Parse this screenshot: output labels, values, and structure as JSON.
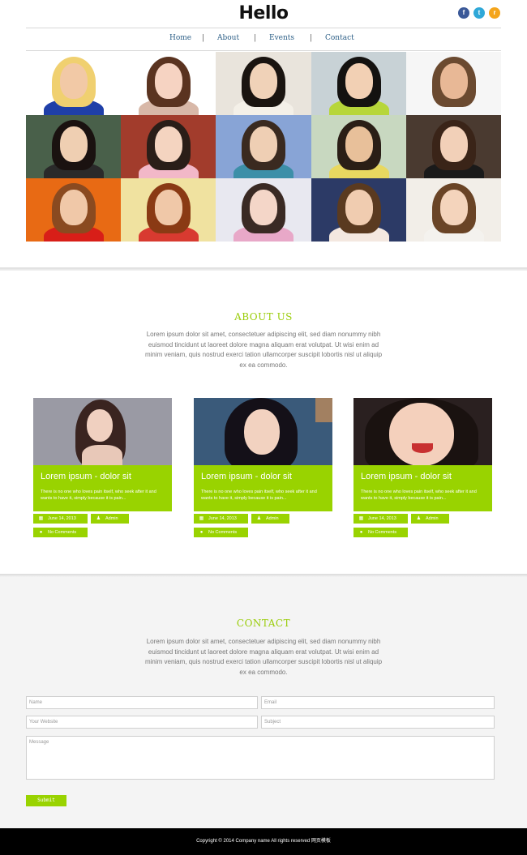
{
  "header": {
    "logo": "Hello",
    "social": [
      {
        "icon": "facebook-icon",
        "glyph": "f",
        "color": "#3b5998"
      },
      {
        "icon": "twitter-icon",
        "glyph": "t",
        "color": "#2fa8d8"
      },
      {
        "icon": "rss-icon",
        "glyph": "r",
        "color": "#f4a51c"
      }
    ]
  },
  "nav": {
    "items": [
      "Home",
      "About",
      "Events",
      "Contact"
    ],
    "separator": "|"
  },
  "gallery": {
    "tiles": [
      {
        "bg": "#ffffff",
        "skin": "#f2c9a6",
        "hair": "#f0d070",
        "shirt": "#1f3fa8"
      },
      {
        "bg": "#ffffff",
        "skin": "#f6d3c2",
        "hair": "#5a3320",
        "shirt": "#d8b8a8"
      },
      {
        "bg": "#e9e4dc",
        "skin": "#f0d2b8",
        "hair": "#1a1410",
        "shirt": "#f4f0e8"
      },
      {
        "bg": "#c8d2d6",
        "skin": "#f2d0b4",
        "hair": "#141210",
        "shirt": "#b7d63a"
      },
      {
        "bg": "#f6f6f6",
        "skin": "#e8b896",
        "hair": "#6b4a30",
        "shirt": "#f6f6f6"
      },
      {
        "bg": "#49604a",
        "skin": "#efcfb2",
        "hair": "#1a1210",
        "shirt": "#2a2a2a"
      },
      {
        "bg": "#a23c2c",
        "skin": "#f4d4c0",
        "hair": "#2a1e18",
        "shirt": "#f2b8c8"
      },
      {
        "bg": "#88a4d6",
        "skin": "#efcfb4",
        "hair": "#3a2a20",
        "shirt": "#3c8fa8"
      },
      {
        "bg": "#c8d8c0",
        "skin": "#e8c09a",
        "hair": "#2a1e16",
        "shirt": "#e8d860"
      },
      {
        "bg": "#4a3a30",
        "skin": "#f2d0b8",
        "hair": "#3a2418",
        "shirt": "#1a1a1a"
      },
      {
        "bg": "#e86a14",
        "skin": "#f0c8a8",
        "hair": "#8a4a20",
        "shirt": "#d81e18"
      },
      {
        "bg": "#f0e2a0",
        "skin": "#f0c8a8",
        "hair": "#8a3a14",
        "shirt": "#d83a30"
      },
      {
        "bg": "#e8e8f0",
        "skin": "#f4d6c8",
        "hair": "#3a2a24",
        "shirt": "#e8a8c8"
      },
      {
        "bg": "#2c3a66",
        "skin": "#f0ccb0",
        "hair": "#5a3a20",
        "shirt": "#f4e8e0"
      },
      {
        "bg": "#f2eee8",
        "skin": "#f4d4bc",
        "hair": "#6a4426",
        "shirt": "#f4f2ee"
      }
    ]
  },
  "about": {
    "title": "ABOUT US",
    "text": "Lorem ipsum dolor sit amet, consectetuer adipiscing elit, sed diam nonummy nibh euismod tincidunt ut laoreet dolore magna aliquam erat volutpat. Ut wisi enim ad minim veniam, quis nostrud exerci tation ullamcorper suscipit lobortis nisl ut aliquip ex ea commodo."
  },
  "cards": [
    {
      "title": "Lorem ipsum - dolor sit",
      "text": "There is no one who loves pain itself, who seek after it and wants to have it, simply because it is pain...",
      "date": "June 14, 2013",
      "author": "Admin",
      "comments": "No Comments",
      "img_bg": "#9a9aa4",
      "skin": "#f0d0c0",
      "hair": "#3a2420"
    },
    {
      "title": "Lorem ipsum - dolor sit",
      "text": "There is no one who loves pain itself, who seek after it and wants to have it, simply because it is pain...",
      "date": "June 14, 2013",
      "author": "Admin",
      "comments": "No Comments",
      "img_bg": "#3a5a7a",
      "skin": "#f2d2c0",
      "hair": "#141018"
    },
    {
      "title": "Lorem ipsum - dolor sit",
      "text": "There is no one who loves pain itself, who seek after it and wants to have it, simply because it is pain...",
      "date": "June 14, 2013",
      "author": "Admin",
      "comments": "No Comments",
      "img_bg": "#2a2020",
      "skin": "#f4d0bc",
      "hair": "#1a1210"
    }
  ],
  "contact": {
    "title": "CONTACT",
    "text": "Lorem ipsum dolor sit amet, consectetuer adipiscing elit, sed diam nonummy nibh euismod tincidunt ut laoreet dolore magna aliquam erat volutpat. Ut wisi enim ad minim veniam, quis nostrud exerci tation ullamcorper suscipit lobortis nisl ut aliquip ex ea commodo.",
    "name_placeholder": "Name",
    "email_placeholder": "Email",
    "website_placeholder": "Your Website",
    "subject_placeholder": "Subject",
    "message_placeholder": "Message",
    "submit_label": "Submit"
  },
  "footer": {
    "text": "Copyright © 2014 Company name All rights reserved 网页模板"
  },
  "colors": {
    "accent": "#99d300",
    "nav_link": "#2b5e86"
  }
}
